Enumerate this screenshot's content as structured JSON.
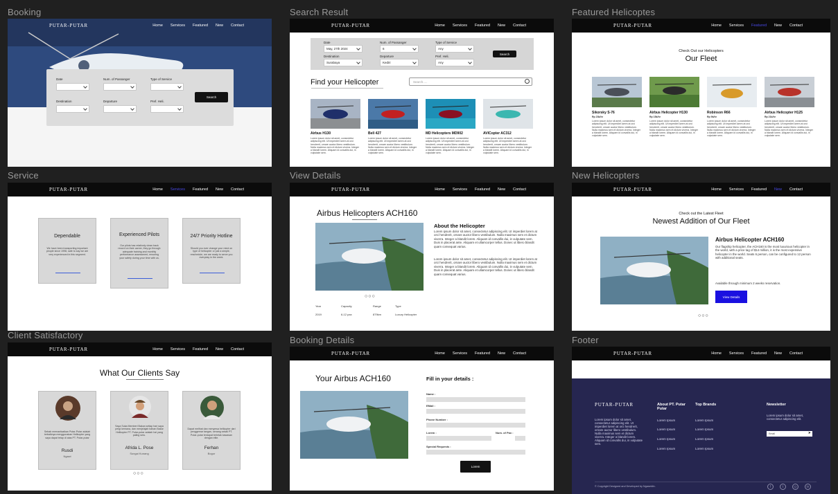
{
  "nav": {
    "logo": "PUTAR-PUTAR",
    "links": [
      "Home",
      "Services",
      "Featured",
      "New",
      "Contact"
    ]
  },
  "frames": {
    "booking": "Booking",
    "search": "Search Result",
    "featured": "Featured Helicoptes",
    "service": "Service",
    "view": "View Details",
    "new": "New Helicopters",
    "client": "Client Satisfactory",
    "bookingdetails": "Booking Details",
    "footer": "Footer"
  },
  "booking": {
    "labels": [
      "Date",
      "Num. of Passanger",
      "Type of Service",
      "Destination",
      "Departure",
      "Pref. Heli."
    ],
    "search": "Search"
  },
  "search": {
    "fields": [
      {
        "label": "Date",
        "value": "May, 27th 2024"
      },
      {
        "label": "Num. of Passanger",
        "value": "6"
      },
      {
        "label": "Type of Service",
        "value": "Any"
      },
      {
        "label": "Destination",
        "value": "Surabaya"
      },
      {
        "label": "Departure",
        "value": "Kediri"
      },
      {
        "label": "Pref. Heli.",
        "value": "Any"
      }
    ],
    "search_button": "Search",
    "heading": "Find your Helicopter",
    "search_placeholder": "Search.....",
    "cards": [
      "Airbus H130",
      "Bell 427",
      "MD Helicopters MD902",
      "AVICopter AC312"
    ]
  },
  "lorem_short": "Lorem ipsum dolor sit amet, consectetur adipiscing elit. Ut imperdiet lorem at orci hendrerit, ornare auctor libero vestibulum. Nulla maximus sem et dictum viverra. Integer a blandit lorem. Aliquam id convallis dui, in vulputate sem.",
  "featured": {
    "kicker": "Check Out our Helicopters",
    "heading": "Our Fleet",
    "cards": [
      {
        "name": "Sikorsky S-76",
        "price": "Rp 23k/hr"
      },
      {
        "name": "Airbus Helicopter H130",
        "price": "Rp 15k/hr"
      },
      {
        "name": "Robinson R66",
        "price": "Rp 9k/hr"
      },
      {
        "name": "Airbus Helicopter H125",
        "price": "Rp 21k/hr"
      }
    ]
  },
  "service": {
    "cards": [
      {
        "title": "Dependable",
        "text": "We have been transporting important people since 1998, safe to say we are very experienced in this segment."
      },
      {
        "title": "Experienced Pilots",
        "text": "Our pilots has relatively clean track record on their career, they go through adequate training and monthly performance assessment, ensuring your safety during your time with us."
      },
      {
        "title": "24/7 Priority Hotline",
        "text": "Should you ever change your mind on type of helicopter or just a simple, reschedule, we are ready to serve you everyday in the week."
      }
    ]
  },
  "view": {
    "title": "Airbus Helicopters ACH160",
    "about_title": "About the Helicopter",
    "p1": "Lorem ipsum dolor sit amet, consectetur adipiscing elit. Ut imperdiet lorem at orci hendrerit, ornare auctor libero vestibulum. Nulla maximus sem et dictum viverra. Integer a blandit lorem. Aliquam id convallis dui, in vulputate sem. Duis in placerat ante. Aliquam et ullamcorper tellus. Donec ut libero blandit quam consequat varius.",
    "p2": "Lorem ipsum dolor sit amet, consectetur adipiscing elit. Ut imperdiet lorem at orci hendrerit, ornare auctor libero vestibulum. Nulla maximus sem et dictum viverra. Integer a blandit lorem. Aliquam id convallis dui, in vulputate sem. Duis in placerat ante. Aliquam et ullamcorper tellus. Donec ut libero blandit quam consequat varius.",
    "specs_labels": [
      "Year",
      "Capacity",
      "Range",
      "Type"
    ],
    "specs_values": [
      "2019",
      "6-12 pax",
      "879km",
      "Luxury Helicopter"
    ]
  },
  "newheli": {
    "kicker": "Check out the Latest Fleet",
    "heading": "Newest Addition of Our Fleet",
    "name": "Airbus Helicopter ACH160",
    "text": "Our flagship helicopter, the ACH160 is the most luxurious helicopter in the world, with a price tag of $14 million, it is the most expensive helicopter in the world. Seats 6 person, can be configured to 12 person with additional seats.",
    "avail": "Available through minimum 2 weeks reservation.",
    "button": "View Details"
  },
  "client": {
    "heading": "What Our Clients Say",
    "cards": [
      {
        "quote": "Sebab memanfaatkan Putar-Putar adalah terbaiknya menggunakan Helikopter yang saya dapat tetap di atas PT. Putar-putar",
        "name": "Rusdi",
        "place": "Ngawi"
      },
      {
        "quote": "Saya Suka Memberi Bakan setiap hari saya pergi kemana, dan menjelajah bahan Bakar Helikopter PT. Putar-putar adalah hal yang paling seru.",
        "name": "Afrida L. Pose",
        "place": "Sungai Kunang"
      },
      {
        "quote": "Dapat melihat dan menyewa helikopter dari penggemar tangan, senang sekali PT. Putar-putar terdapat terletak kawasan dengan elite.",
        "name": "Ferhan",
        "place": "Bogor"
      }
    ]
  },
  "bookingdetails": {
    "title": "Your Airbus ACH160",
    "form_title": "Fill in your details :",
    "labels": [
      "Name :",
      "EMail :",
      "Phone Number :",
      "Lorem :",
      "Num. of Pax :",
      "Special Requests :"
    ],
    "submit": "Lorem"
  },
  "footer": {
    "logo": "PUTAR-PUTAR",
    "about": "Lorem ipsum dolor sit amet, consectetur adipiscing elit. Ut imperdiet lorem at orci hendrerit, ornare auctor libero vestibulum. Nulla maximus sem et dictum viverra. Integer a blandit lorem. Aliquam id convallis dui, in vulputate sem.",
    "col1_title": "About PT. Putar Putar",
    "col2_title": "Top Brands",
    "items": [
      "Lorem Ipsum",
      "Lorem Ipsum",
      "Lorem Ipsum",
      "Lorem Ipsum"
    ],
    "newsletter_title": "Newsletter",
    "newsletter_text": "Lorem ipsum dolor sit amet, consectetur adipiscing elit.",
    "email_placeholder": "Email",
    "copyright": "© Copyright Designed and Developed by Ngaseklin."
  },
  "colors": {
    "blue_accent": "#1a10e0",
    "footer_bg": "#262650",
    "nav_bg": "#0b0b0b"
  }
}
